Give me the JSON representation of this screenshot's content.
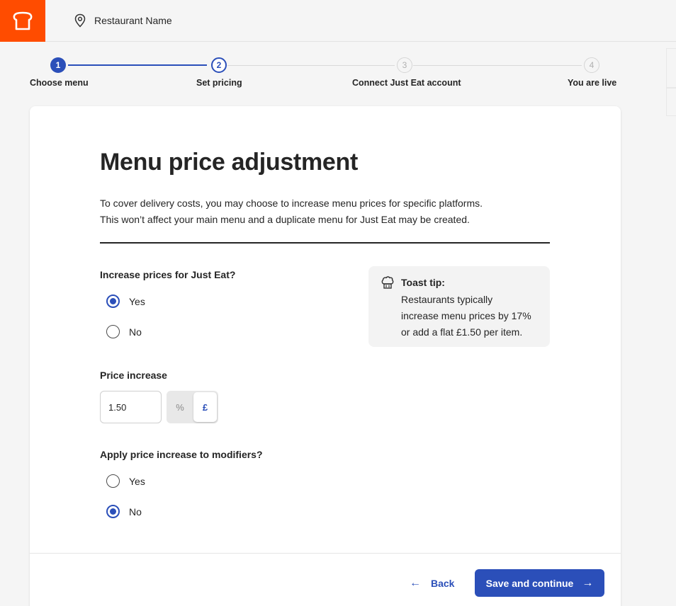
{
  "header": {
    "logo_icon": "toast-logo-icon",
    "location_icon": "location-pin-icon",
    "restaurant_name": "Restaurant Name"
  },
  "stepper": {
    "steps": [
      {
        "number": "1",
        "label": "Choose menu",
        "state": "done"
      },
      {
        "number": "2",
        "label": "Set pricing",
        "state": "current"
      },
      {
        "number": "3",
        "label": "Connect Just Eat account",
        "state": "todo"
      },
      {
        "number": "4",
        "label": "You are live",
        "state": "todo"
      }
    ]
  },
  "main": {
    "title": "Menu price adjustment",
    "description_line1": "To cover delivery costs, you may choose to increase menu prices for specific platforms.",
    "description_line2": "This won’t affect your main menu and a duplicate menu for Just Eat may be created.",
    "increase_question": "Increase prices for Just Eat?",
    "increase_options": [
      {
        "label": "Yes",
        "checked": true
      },
      {
        "label": "No",
        "checked": false
      }
    ],
    "tip": {
      "icon": "chef-hat-icon",
      "title": "Toast tip:",
      "line1": "Restaurants typically",
      "line2": "increase menu prices by 17%",
      "line3": "or add a flat £1.50 per item."
    },
    "price_label": "Price increase",
    "price_value": "1.50",
    "unit_percent": "%",
    "unit_pound": "£",
    "unit_selected": "£",
    "modifiers_question": "Apply price increase to modifiers?",
    "modifiers_options": [
      {
        "label": "Yes",
        "checked": false
      },
      {
        "label": "No",
        "checked": true
      }
    ]
  },
  "footer": {
    "back_label": "Back",
    "save_label": "Save and continue",
    "back_arrow": "←",
    "save_arrow": "→"
  },
  "colors": {
    "brand": "#ff4c00",
    "accent": "#2b4fb9",
    "background": "#f5f5f5"
  }
}
